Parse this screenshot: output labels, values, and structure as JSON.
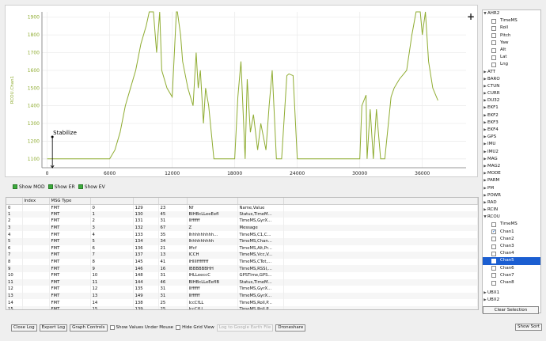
{
  "graph": {
    "ylabel": "RCOU.Chan1",
    "mode_label": "Stabilize",
    "line_color": "#8fac31",
    "chart_data": {
      "type": "line",
      "title": "",
      "xlabel": "",
      "ylabel": "RCOU.Chan1",
      "xlim": [
        -500,
        40200
      ],
      "ylim": [
        1050,
        1930
      ],
      "xticks": [
        0,
        6000,
        12000,
        18000,
        24000,
        30000,
        36000
      ],
      "yticks": [
        1100,
        1200,
        1300,
        1400,
        1500,
        1600,
        1700,
        1800,
        1900
      ],
      "grid": true,
      "series": [
        {
          "x": [
            0,
            1000,
            2000,
            3000,
            4000,
            5000,
            6000,
            6500,
            7000,
            7500,
            8000,
            8500,
            9000,
            9500,
            9800,
            10000,
            10200,
            10500,
            10800,
            11000,
            11500,
            12000,
            12400,
            12500,
            12800,
            13000,
            13500,
            14000,
            14300,
            14500,
            14700,
            15000,
            15200,
            15500,
            16000,
            16500,
            17000,
            17500,
            18000,
            18300,
            18600,
            19000,
            19200,
            19500,
            19800,
            20200,
            20500,
            21000,
            21300,
            21600,
            22000,
            22500,
            23000,
            23200,
            23600,
            24000,
            24300,
            25000,
            26000,
            27000,
            27500,
            28000,
            28500,
            29000,
            30000,
            30200,
            30600,
            30700,
            31000,
            31300,
            31600,
            32000,
            32400,
            33000,
            33300,
            33800,
            34500,
            35000,
            35400,
            35800,
            36000,
            36300,
            36600,
            37000,
            37500
          ],
          "y": [
            1100,
            1100,
            1100,
            1100,
            1100,
            1100,
            1100,
            1150,
            1250,
            1400,
            1500,
            1600,
            1750,
            1850,
            1930,
            1930,
            1930,
            1700,
            1930,
            1600,
            1500,
            1450,
            1930,
            1930,
            1800,
            1650,
            1500,
            1400,
            1700,
            1500,
            1600,
            1300,
            1500,
            1400,
            1100,
            1100,
            1100,
            1100,
            1100,
            1450,
            1650,
            1100,
            1550,
            1250,
            1350,
            1150,
            1300,
            1150,
            1400,
            1600,
            1100,
            1100,
            1570,
            1580,
            1570,
            1100,
            1100,
            1100,
            1100,
            1100,
            1100,
            1100,
            1100,
            1100,
            1100,
            1400,
            1460,
            1100,
            1380,
            1100,
            1380,
            1100,
            1100,
            1450,
            1500,
            1550,
            1600,
            1800,
            1930,
            1930,
            1800,
            1930,
            1650,
            1500,
            1430
          ]
        }
      ]
    }
  },
  "checks": [
    {
      "label": "Show MOD"
    },
    {
      "label": "Show ER"
    },
    {
      "label": "Show EV"
    }
  ],
  "tree": {
    "plus": "+",
    "items": [
      {
        "label": "AHR2",
        "kind": "open"
      },
      {
        "label": "TimeMS",
        "kind": "child"
      },
      {
        "label": "Roll",
        "kind": "child"
      },
      {
        "label": "Pitch",
        "kind": "child"
      },
      {
        "label": "Yaw",
        "kind": "child"
      },
      {
        "label": "Alt",
        "kind": "child"
      },
      {
        "label": "Lat",
        "kind": "child"
      },
      {
        "label": "Lng",
        "kind": "child"
      },
      {
        "label": "ATT",
        "kind": "closed"
      },
      {
        "label": "BARO",
        "kind": "closed"
      },
      {
        "label": "CTUN",
        "kind": "closed"
      },
      {
        "label": "CURR",
        "kind": "closed"
      },
      {
        "label": "DU32",
        "kind": "closed"
      },
      {
        "label": "EKF1",
        "kind": "closed"
      },
      {
        "label": "EKF2",
        "kind": "closed"
      },
      {
        "label": "EKF3",
        "kind": "closed"
      },
      {
        "label": "EKF4",
        "kind": "closed"
      },
      {
        "label": "GPS",
        "kind": "closed"
      },
      {
        "label": "IMU",
        "kind": "closed"
      },
      {
        "label": "IMU2",
        "kind": "closed"
      },
      {
        "label": "MAG",
        "kind": "closed"
      },
      {
        "label": "MAG2",
        "kind": "closed"
      },
      {
        "label": "MODE",
        "kind": "closed"
      },
      {
        "label": "PARM",
        "kind": "closed"
      },
      {
        "label": "PM",
        "kind": "closed"
      },
      {
        "label": "POWR",
        "kind": "closed"
      },
      {
        "label": "RAD",
        "kind": "closed"
      },
      {
        "label": "RCIN",
        "kind": "closed"
      },
      {
        "label": "RCOU",
        "kind": "open"
      },
      {
        "label": "TimeMS",
        "kind": "child"
      },
      {
        "label": "Chan1",
        "kind": "child",
        "checked": true
      },
      {
        "label": "Chan2",
        "kind": "child"
      },
      {
        "label": "Chan3",
        "kind": "child"
      },
      {
        "label": "Chan4",
        "kind": "child"
      },
      {
        "label": "Chan5",
        "kind": "child",
        "selected": true
      },
      {
        "label": "Chan6",
        "kind": "child"
      },
      {
        "label": "Chan7",
        "kind": "child"
      },
      {
        "label": "Chan8",
        "kind": "child"
      },
      {
        "label": "UBX1",
        "kind": "closed",
        "gap": true
      },
      {
        "label": "UBX2",
        "kind": "closed"
      }
    ],
    "clear_label": "Clear Selection"
  },
  "table": {
    "columns": [
      "",
      "Index",
      "MSG Type",
      "",
      "",
      "",
      "",
      "",
      ""
    ],
    "rows": [
      [
        "0",
        "",
        "FMT",
        "0",
        "129",
        "23",
        "Nf",
        "Name,Value",
        ""
      ],
      [
        "1",
        "",
        "FMT",
        "1",
        "130",
        "45",
        "BIHBcLLeeEefI",
        "Status,TimeM...",
        ""
      ],
      [
        "2",
        "",
        "FMT",
        "2",
        "131",
        "31",
        "IIffffff",
        "TimeMS,GyrX...",
        ""
      ],
      [
        "3",
        "",
        "FMT",
        "3",
        "132",
        "67",
        "Z",
        "Message",
        ""
      ],
      [
        "4",
        "",
        "FMT",
        "4",
        "133",
        "35",
        "Ihhhhhhhhh...",
        "TimeMS,C1,C...",
        ""
      ],
      [
        "5",
        "",
        "FMT",
        "5",
        "134",
        "34",
        "Ihhhhhhhhh",
        "TimeMS,Chan...",
        ""
      ],
      [
        "6",
        "",
        "FMT",
        "6",
        "136",
        "21",
        "Iffcf",
        "TimeMS,Alt,Pr...",
        ""
      ],
      [
        "7",
        "",
        "FMT",
        "7",
        "137",
        "13",
        "ICCH",
        "TimeMS,Vcc,V...",
        ""
      ],
      [
        "8",
        "",
        "FMT",
        "8",
        "145",
        "41",
        "IHIIIffffffff",
        "TimeMS,CTot,...",
        ""
      ],
      [
        "9",
        "",
        "FMT",
        "9",
        "146",
        "16",
        "IBBBBBBHH",
        "TimeMS,RSSI,...",
        ""
      ],
      [
        "10",
        "",
        "FMT",
        "10",
        "148",
        "31",
        "IHLLeeccC",
        "GPSTime,GPS...",
        ""
      ],
      [
        "11",
        "",
        "FMT",
        "11",
        "144",
        "46",
        "BIHBcLLeEefIB",
        "Status,TimeM...",
        ""
      ],
      [
        "12",
        "",
        "FMT",
        "12",
        "135",
        "31",
        "IIffffff",
        "TimeMS,GyrX...",
        ""
      ],
      [
        "13",
        "",
        "FMT",
        "13",
        "149",
        "31",
        "IIffffff",
        "TimeMS,GyrX...",
        ""
      ],
      [
        "14",
        "",
        "FMT",
        "14",
        "138",
        "25",
        "IccCfLL",
        "TimeMS,Roll,P...",
        ""
      ],
      [
        "15",
        "",
        "FMT",
        "15",
        "139",
        "25",
        "IccCfLL",
        "TimeMS,Roll,P...",
        ""
      ],
      [
        "16",
        "",
        "FMT",
        "16",
        "140",
        "43",
        "IccCffffffccc",
        "TimeMS,Roll,P...",
        ""
      ],
      [
        "17",
        "",
        "FMT",
        "17",
        "141",
        "26",
        "Ihhhcchhhhhh",
        "TimeMS,AX,A...",
        ""
      ]
    ]
  },
  "bottom": {
    "close_log": "Close Log",
    "export_log": "Export Log",
    "graph_controls": "Graph Controls",
    "show_values": "Show Values Under Mouse",
    "hide_grid": "Hide Grid View",
    "google_earth": "Log to Google Earth File",
    "droneshare": "Droneshare",
    "show_sort": "Show Sort"
  }
}
